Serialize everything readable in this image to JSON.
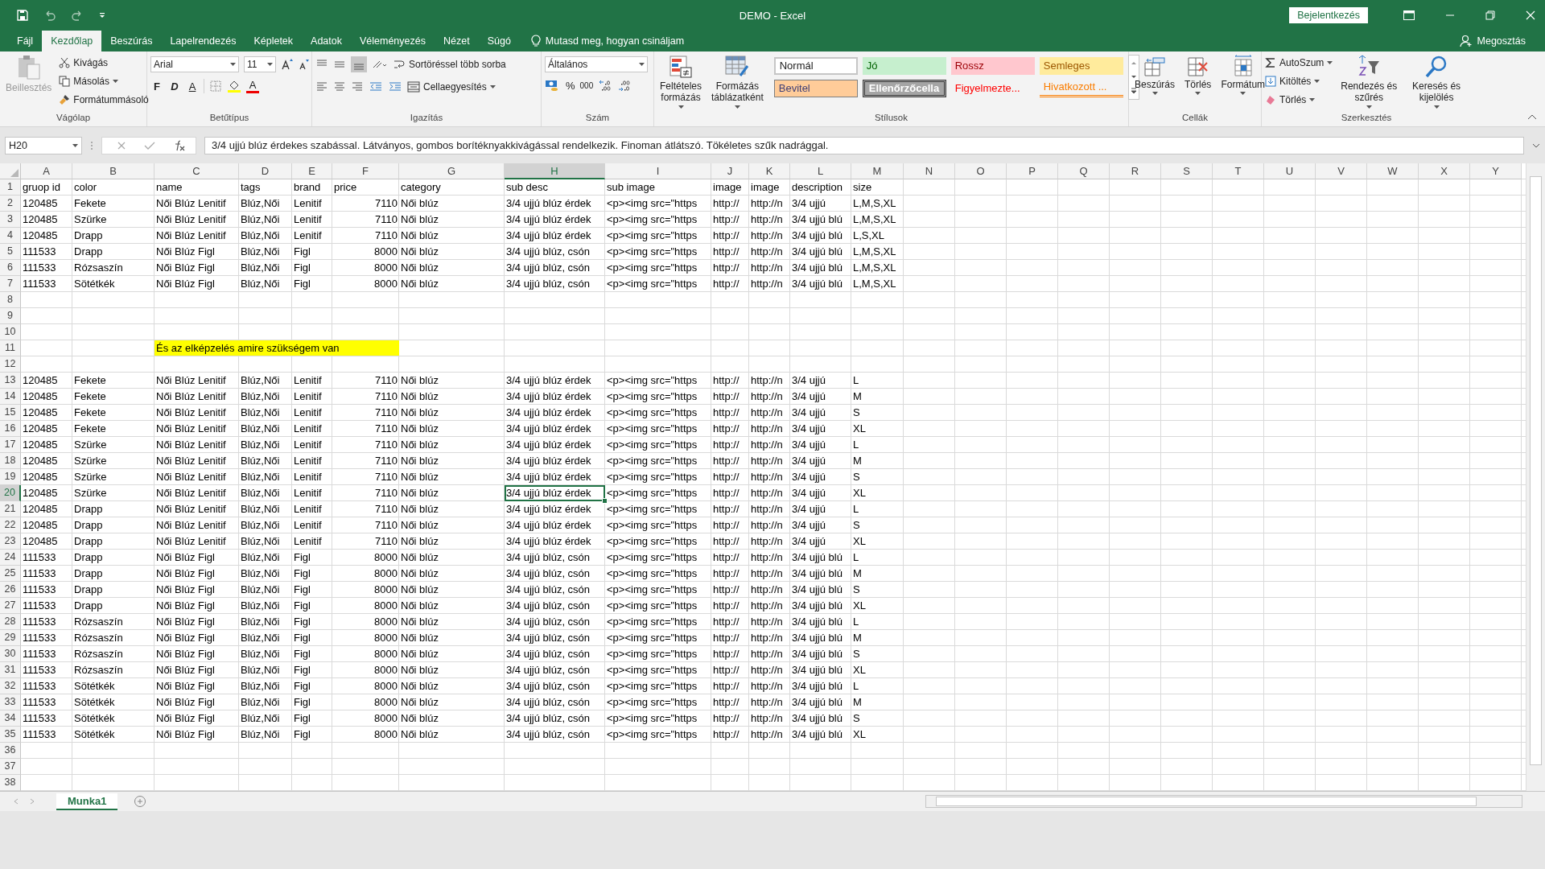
{
  "window": {
    "title": "DEMO - Excel",
    "sign_in": "Bejelentkezés"
  },
  "ribbon_tabs": [
    {
      "label": "Fájl",
      "selected": false
    },
    {
      "label": "Kezdőlap",
      "selected": true
    },
    {
      "label": "Beszúrás",
      "selected": false
    },
    {
      "label": "Lapelrendezés",
      "selected": false
    },
    {
      "label": "Képletek",
      "selected": false
    },
    {
      "label": "Adatok",
      "selected": false
    },
    {
      "label": "Véleményezés",
      "selected": false
    },
    {
      "label": "Nézet",
      "selected": false
    },
    {
      "label": "Súgó",
      "selected": false
    }
  ],
  "tell_me": "Mutasd meg, hogyan csináljam",
  "share": "Megosztás",
  "ribbon": {
    "clipboard": {
      "paste": "Beillesztés",
      "cut": "Kivágás",
      "copy": "Másolás",
      "format_painter": "Formátummásoló",
      "label": "Vágólap"
    },
    "font": {
      "name": "Arial",
      "size": "11",
      "bold": "F",
      "italic": "D",
      "underline": "A",
      "font_color": "A",
      "label": "Betűtípus"
    },
    "alignment": {
      "wrap": "Sortöréssel több sorba",
      "merge": "Cellaegyesítés",
      "label": "Igazítás"
    },
    "number": {
      "format": "Általános",
      "percent": "%",
      "thousands": "000",
      "label": "Szám"
    },
    "styles": {
      "conditional": "Feltételes formázás",
      "as_table": "Formázás táblázatként",
      "label": "Stílusok",
      "gallery": [
        {
          "label": "Normál",
          "kind": "normal"
        },
        {
          "label": "Jó",
          "kind": "good"
        },
        {
          "label": "Rossz",
          "kind": "bad"
        },
        {
          "label": "Semleges",
          "kind": "neutral"
        },
        {
          "label": "Bevitel",
          "kind": "input"
        },
        {
          "label": "Ellenőrzőcella",
          "kind": "check"
        },
        {
          "label": "Figyelmezte...",
          "kind": "warning"
        },
        {
          "label": "Hivatkozott ...",
          "kind": "linked"
        }
      ]
    },
    "cells": {
      "insert": "Beszúrás",
      "delete": "Törlés",
      "format": "Formátum",
      "label": "Cellák"
    },
    "editing": {
      "autosum": "AutoSzum",
      "fill": "Kitöltés",
      "clear": "Törlés",
      "sort": "Rendezés és szűrés",
      "find": "Keresés és kijelölés",
      "label": "Szerkesztés"
    }
  },
  "formula_bar": {
    "name_box": "H20",
    "formula": "3/4 ujjú blúz érdekes szabással. Látványos, gombos borítéknyakkivágással rendelkezik. Finoman átlátszó. Tökéletes szűk nadrággal."
  },
  "columns": [
    {
      "label": "A",
      "selected": false
    },
    {
      "label": "B",
      "selected": false
    },
    {
      "label": "C",
      "selected": false
    },
    {
      "label": "D",
      "selected": false
    },
    {
      "label": "E",
      "selected": false
    },
    {
      "label": "F",
      "selected": false
    },
    {
      "label": "G",
      "selected": false
    },
    {
      "label": "H",
      "selected": true
    },
    {
      "label": "I",
      "selected": false
    },
    {
      "label": "J",
      "selected": false
    },
    {
      "label": "K",
      "selected": false
    },
    {
      "label": "L",
      "selected": false
    },
    {
      "label": "M",
      "selected": false
    },
    {
      "label": "N",
      "selected": false
    },
    {
      "label": "O",
      "selected": false
    },
    {
      "label": "P",
      "selected": false
    },
    {
      "label": "Q",
      "selected": false
    },
    {
      "label": "R",
      "selected": false
    },
    {
      "label": "S",
      "selected": false
    },
    {
      "label": "T",
      "selected": false
    },
    {
      "label": "U",
      "selected": false
    },
    {
      "label": "V",
      "selected": false
    },
    {
      "label": "W",
      "selected": false
    },
    {
      "label": "X",
      "selected": false
    },
    {
      "label": "Y",
      "selected": false
    }
  ],
  "rows": [
    {
      "number": "1",
      "selected": false,
      "cells": [
        "gruop id",
        "color",
        "name",
        "tags",
        "brand",
        "price",
        "category",
        "sub desc",
        "sub image",
        "image",
        "image",
        "description",
        "size"
      ]
    },
    {
      "number": "2",
      "selected": false,
      "cells": [
        "120485",
        "Fekete",
        "Női Blúz Lenitif",
        "Blúz,Női",
        "Lenitif",
        "7110",
        "Női blúz",
        "3/4 ujjú blúz érdek",
        "<p><img src=\"https",
        "http://",
        "http://n",
        "3/4 ujjú",
        "L,M,S,XL"
      ]
    },
    {
      "number": "3",
      "selected": false,
      "cells": [
        "120485",
        "Szürke",
        "Női Blúz Lenitif",
        "Blúz,Női",
        "Lenitif",
        "7110",
        "Női blúz",
        "3/4 ujjú blúz érdek",
        "<p><img src=\"https",
        "http://",
        "http://n",
        "3/4 ujjú blú",
        "L,M,S,XL"
      ]
    },
    {
      "number": "4",
      "selected": false,
      "cells": [
        "120485",
        "Drapp",
        "Női Blúz Lenitif",
        "Blúz,Női",
        "Lenitif",
        "7110",
        "Női blúz",
        "3/4 ujjú blúz érdek",
        "<p><img src=\"https",
        "http://",
        "http://n",
        "3/4 ujjú blú",
        "L,S,XL"
      ]
    },
    {
      "number": "5",
      "selected": false,
      "cells": [
        "111533",
        "Drapp",
        "Női Blúz Figl",
        "Blúz,Női",
        "Figl",
        "8000",
        "Női blúz",
        "3/4 ujjú blúz, csón",
        "<p><img src=\"https",
        "http://",
        "http://n",
        "3/4 ujjú blú",
        "L,M,S,XL"
      ]
    },
    {
      "number": "6",
      "selected": false,
      "cells": [
        "111533",
        "Rózsaszín",
        "Női Blúz Figl",
        "Blúz,Női",
        "Figl",
        "8000",
        "Női blúz",
        "3/4 ujjú blúz, csón",
        "<p><img src=\"https",
        "http://",
        "http://n",
        "3/4 ujjú blú",
        "L,M,S,XL"
      ]
    },
    {
      "number": "7",
      "selected": false,
      "cells": [
        "111533",
        "Sötétkék",
        "Női Blúz Figl",
        "Blúz,Női",
        "Figl",
        "8000",
        "Női blúz",
        "3/4 ujjú blúz, csón",
        "<p><img src=\"https",
        "http://",
        "http://n",
        "3/4 ujjú blú",
        "L,M,S,XL"
      ]
    },
    {
      "number": "8",
      "selected": false
    },
    {
      "number": "9",
      "selected": false
    },
    {
      "number": "10",
      "selected": false
    },
    {
      "number": "11",
      "selected": false,
      "kind": "note",
      "note": "És az elképzelés amire szükségem van"
    },
    {
      "number": "12",
      "selected": false
    },
    {
      "number": "13",
      "selected": false,
      "cells": [
        "120485",
        "Fekete",
        "Női Blúz Lenitif",
        "Blúz,Női",
        "Lenitif",
        "7110",
        "Női blúz",
        "3/4 ujjú blúz érdek",
        "<p><img src=\"https",
        "http://",
        "http://n",
        "3/4 ujjú",
        "L"
      ]
    },
    {
      "number": "14",
      "selected": false,
      "cells": [
        "120485",
        "Fekete",
        "Női Blúz Lenitif",
        "Blúz,Női",
        "Lenitif",
        "7110",
        "Női blúz",
        "3/4 ujjú blúz érdek",
        "<p><img src=\"https",
        "http://",
        "http://n",
        "3/4 ujjú",
        "M"
      ]
    },
    {
      "number": "15",
      "selected": false,
      "cells": [
        "120485",
        "Fekete",
        "Női Blúz Lenitif",
        "Blúz,Női",
        "Lenitif",
        "7110",
        "Női blúz",
        "3/4 ujjú blúz érdek",
        "<p><img src=\"https",
        "http://",
        "http://n",
        "3/4 ujjú",
        "S"
      ]
    },
    {
      "number": "16",
      "selected": false,
      "cells": [
        "120485",
        "Fekete",
        "Női Blúz Lenitif",
        "Blúz,Női",
        "Lenitif",
        "7110",
        "Női blúz",
        "3/4 ujjú blúz érdek",
        "<p><img src=\"https",
        "http://",
        "http://n",
        "3/4 ujjú",
        "XL"
      ]
    },
    {
      "number": "17",
      "selected": false,
      "cells": [
        "120485",
        "Szürke",
        "Női Blúz Lenitif",
        "Blúz,Női",
        "Lenitif",
        "7110",
        "Női blúz",
        "3/4 ujjú blúz érdek",
        "<p><img src=\"https",
        "http://",
        "http://n",
        "3/4 ujjú",
        "L"
      ]
    },
    {
      "number": "18",
      "selected": false,
      "cells": [
        "120485",
        "Szürke",
        "Női Blúz Lenitif",
        "Blúz,Női",
        "Lenitif",
        "7110",
        "Női blúz",
        "3/4 ujjú blúz érdek",
        "<p><img src=\"https",
        "http://",
        "http://n",
        "3/4 ujjú",
        "M"
      ]
    },
    {
      "number": "19",
      "selected": false,
      "cells": [
        "120485",
        "Szürke",
        "Női Blúz Lenitif",
        "Blúz,Női",
        "Lenitif",
        "7110",
        "Női blúz",
        "3/4 ujjú blúz érdek",
        "<p><img src=\"https",
        "http://",
        "http://n",
        "3/4 ujjú",
        "S"
      ]
    },
    {
      "number": "20",
      "selected": true,
      "cells": [
        "120485",
        "Szürke",
        "Női Blúz Lenitif",
        "Blúz,Női",
        "Lenitif",
        "7110",
        "Női blúz",
        "3/4 ujjú blúz érdek",
        "<p><img src=\"https",
        "http://",
        "http://n",
        "3/4 ujjú",
        "XL"
      ]
    },
    {
      "number": "21",
      "selected": false,
      "cells": [
        "120485",
        "Drapp",
        "Női Blúz Lenitif",
        "Blúz,Női",
        "Lenitif",
        "7110",
        "Női blúz",
        "3/4 ujjú blúz érdek",
        "<p><img src=\"https",
        "http://",
        "http://n",
        "3/4 ujjú",
        "L"
      ]
    },
    {
      "number": "22",
      "selected": false,
      "cells": [
        "120485",
        "Drapp",
        "Női Blúz Lenitif",
        "Blúz,Női",
        "Lenitif",
        "7110",
        "Női blúz",
        "3/4 ujjú blúz érdek",
        "<p><img src=\"https",
        "http://",
        "http://n",
        "3/4 ujjú",
        "S"
      ]
    },
    {
      "number": "23",
      "selected": false,
      "cells": [
        "120485",
        "Drapp",
        "Női Blúz Lenitif",
        "Blúz,Női",
        "Lenitif",
        "7110",
        "Női blúz",
        "3/4 ujjú blúz érdek",
        "<p><img src=\"https",
        "http://",
        "http://n",
        "3/4 ujjú",
        "XL"
      ]
    },
    {
      "number": "24",
      "selected": false,
      "cells": [
        "111533",
        "Drapp",
        "Női Blúz Figl",
        "Blúz,Női",
        "Figl",
        "8000",
        "Női blúz",
        "3/4 ujjú blúz, csón",
        "<p><img src=\"https",
        "http://",
        "http://n",
        "3/4 ujjú blú",
        "L"
      ]
    },
    {
      "number": "25",
      "selected": false,
      "cells": [
        "111533",
        "Drapp",
        "Női Blúz Figl",
        "Blúz,Női",
        "Figl",
        "8000",
        "Női blúz",
        "3/4 ujjú blúz, csón",
        "<p><img src=\"https",
        "http://",
        "http://n",
        "3/4 ujjú blú",
        "M"
      ]
    },
    {
      "number": "26",
      "selected": false,
      "cells": [
        "111533",
        "Drapp",
        "Női Blúz Figl",
        "Blúz,Női",
        "Figl",
        "8000",
        "Női blúz",
        "3/4 ujjú blúz, csón",
        "<p><img src=\"https",
        "http://",
        "http://n",
        "3/4 ujjú blú",
        "S"
      ]
    },
    {
      "number": "27",
      "selected": false,
      "cells": [
        "111533",
        "Drapp",
        "Női Blúz Figl",
        "Blúz,Női",
        "Figl",
        "8000",
        "Női blúz",
        "3/4 ujjú blúz, csón",
        "<p><img src=\"https",
        "http://",
        "http://n",
        "3/4 ujjú blú",
        "XL"
      ]
    },
    {
      "number": "28",
      "selected": false,
      "cells": [
        "111533",
        "Rózsaszín",
        "Női Blúz Figl",
        "Blúz,Női",
        "Figl",
        "8000",
        "Női blúz",
        "3/4 ujjú blúz, csón",
        "<p><img src=\"https",
        "http://",
        "http://n",
        "3/4 ujjú blú",
        "L"
      ]
    },
    {
      "number": "29",
      "selected": false,
      "cells": [
        "111533",
        "Rózsaszín",
        "Női Blúz Figl",
        "Blúz,Női",
        "Figl",
        "8000",
        "Női blúz",
        "3/4 ujjú blúz, csón",
        "<p><img src=\"https",
        "http://",
        "http://n",
        "3/4 ujjú blú",
        "M"
      ]
    },
    {
      "number": "30",
      "selected": false,
      "cells": [
        "111533",
        "Rózsaszín",
        "Női Blúz Figl",
        "Blúz,Női",
        "Figl",
        "8000",
        "Női blúz",
        "3/4 ujjú blúz, csón",
        "<p><img src=\"https",
        "http://",
        "http://n",
        "3/4 ujjú blú",
        "S"
      ]
    },
    {
      "number": "31",
      "selected": false,
      "cells": [
        "111533",
        "Rózsaszín",
        "Női Blúz Figl",
        "Blúz,Női",
        "Figl",
        "8000",
        "Női blúz",
        "3/4 ujjú blúz, csón",
        "<p><img src=\"https",
        "http://",
        "http://n",
        "3/4 ujjú blú",
        "XL"
      ]
    },
    {
      "number": "32",
      "selected": false,
      "cells": [
        "111533",
        "Sötétkék",
        "Női Blúz Figl",
        "Blúz,Női",
        "Figl",
        "8000",
        "Női blúz",
        "3/4 ujjú blúz, csón",
        "<p><img src=\"https",
        "http://",
        "http://n",
        "3/4 ujjú blú",
        "L"
      ]
    },
    {
      "number": "33",
      "selected": false,
      "cells": [
        "111533",
        "Sötétkék",
        "Női Blúz Figl",
        "Blúz,Női",
        "Figl",
        "8000",
        "Női blúz",
        "3/4 ujjú blúz, csón",
        "<p><img src=\"https",
        "http://",
        "http://n",
        "3/4 ujjú blú",
        "M"
      ]
    },
    {
      "number": "34",
      "selected": false,
      "cells": [
        "111533",
        "Sötétkék",
        "Női Blúz Figl",
        "Blúz,Női",
        "Figl",
        "8000",
        "Női blúz",
        "3/4 ujjú blúz, csón",
        "<p><img src=\"https",
        "http://",
        "http://n",
        "3/4 ujjú blú",
        "S"
      ]
    },
    {
      "number": "35",
      "selected": false,
      "cells": [
        "111533",
        "Sötétkék",
        "Női Blúz Figl",
        "Blúz,Női",
        "Figl",
        "8000",
        "Női blúz",
        "3/4 ujjú blúz, csón",
        "<p><img src=\"https",
        "http://",
        "http://n",
        "3/4 ujjú blú",
        "XL"
      ]
    },
    {
      "number": "36",
      "selected": false
    },
    {
      "number": "37",
      "selected": false
    },
    {
      "number": "38",
      "selected": false
    }
  ],
  "sheet_tabs": [
    {
      "label": "Munka1",
      "selected": true
    }
  ]
}
